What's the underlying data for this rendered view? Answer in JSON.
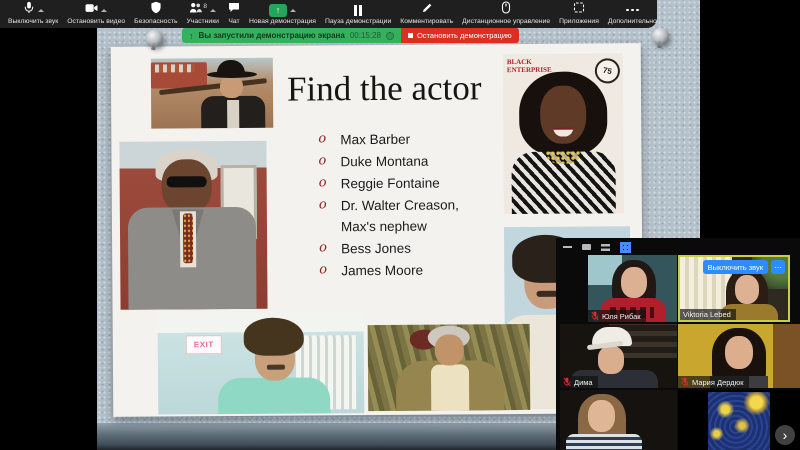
{
  "toolbar": {
    "items": [
      {
        "label": "Выключить звук"
      },
      {
        "label": "Остановить видео"
      },
      {
        "label": "Безопасность"
      },
      {
        "label": "Участники",
        "badge": "8"
      },
      {
        "label": "Чат"
      },
      {
        "label": "Новая демонстрация"
      },
      {
        "label": "Пауза демонстрации"
      },
      {
        "label": "Комментировать"
      },
      {
        "label": "Дистанционное управление"
      },
      {
        "label": "Приложения"
      },
      {
        "label": "Дополнительно"
      }
    ]
  },
  "share_banner": {
    "message": "Вы запустили демонстрацию экрана",
    "timer": "00:15:28",
    "stop_label": "Остановить демонстрацию"
  },
  "slide": {
    "title": "Find the actor",
    "bullets": [
      "Max Barber",
      "Duke Montana",
      "Reggie Fontaine",
      "Dr. Walter Creason, Max's nephew",
      "Bess Jones",
      "James Moore"
    ],
    "exit_sign": "EXIT",
    "magazine_line1": "BLACK",
    "magazine_line2": "ENTERPRISE",
    "magazine_badge": "75"
  },
  "participants_panel": {
    "participants": [
      {
        "name": "Юля Рибак",
        "muted": true
      },
      {
        "name": "Viktoria Lebed",
        "muted": false
      },
      {
        "name": "Дима",
        "muted": true
      },
      {
        "name": "Мария Дердюк",
        "muted": true
      }
    ],
    "mute_request_label": "Выключить звук",
    "more_label": "⋯",
    "next_label": "›"
  },
  "colors": {
    "accent_green": "#23a65a",
    "banner_green": "#35b05c",
    "stop_red": "#dc2f23",
    "action_blue": "#2d8cff",
    "active_speaker_border": "#cbcf3e"
  }
}
